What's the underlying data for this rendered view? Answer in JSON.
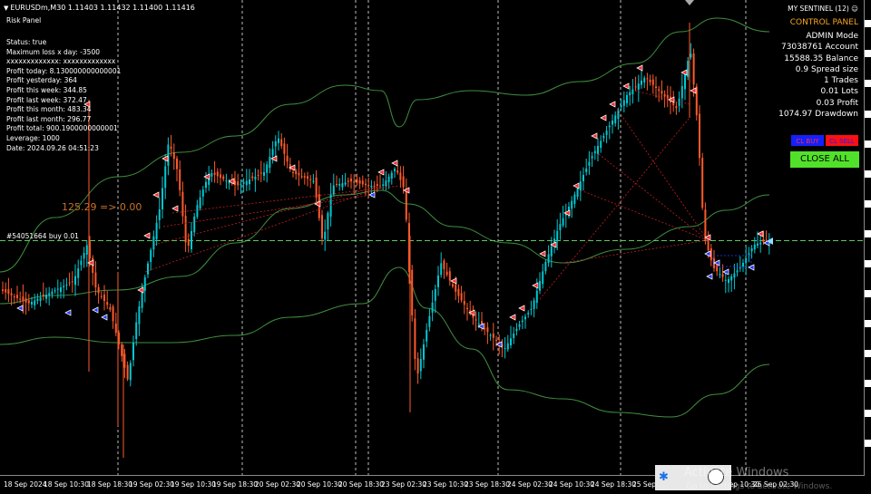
{
  "chart_header": {
    "symbol_line": "EURUSDm,M30  1.11403 1.11432 1.11400 1.11416",
    "risk_panel_title": "Risk Panel"
  },
  "risk_panel": {
    "lines": [
      "Status: true",
      "Maximum loss x day: -3500",
      "xxxxxxxxxxxxx: xxxxxxxxxxxxx",
      "Profit today: 8.130000000000001",
      "Profit yesterday: 364",
      "Profit this week: 344.85",
      "Profit last week: 372.47",
      "Profit this month: 483.34",
      "Profit last month: 296.77",
      "Profit total: 900.1900000000001",
      "Leverage: 1000",
      "Date: 2024.09.26 04:51:23"
    ]
  },
  "expert": {
    "name": "MY SENTINEL (12)",
    "icon": "smiley-icon"
  },
  "control_panel": {
    "title": "CONTROL PANEL",
    "rows": [
      {
        "value": "ADMIN",
        "label": "Mode"
      },
      {
        "value": "73038761",
        "label": "Account"
      },
      {
        "value": "15588.35",
        "label": "Balance"
      },
      {
        "value": "0.9",
        "label": "Spread size"
      },
      {
        "value": "1",
        "label": "Trades"
      },
      {
        "value": "0.01",
        "label": "Lots"
      },
      {
        "value": "0.03",
        "label": "Profit"
      },
      {
        "value": "1074.97",
        "label": "Drawdown"
      }
    ],
    "buy_label": "CL BUY",
    "sell_label": "CL SELL",
    "close_all_label": "CLOSE ALL"
  },
  "position_label": "#54051664 buy 0.01",
  "pl_label": "125.29 => 0.00",
  "x_axis_labels": [
    "18 Sep 2024",
    "18 Sep 10:30",
    "18 Sep 18:30",
    "19 Sep 02:30",
    "19 Sep 10:30",
    "19 Sep 18:30",
    "20 Sep 02:30",
    "20 Sep 10:30",
    "20 Sep 18:30",
    "23 Sep 02:30",
    "23 Sep 10:30",
    "23 Sep 18:30",
    "24 Sep 02:30",
    "24 Sep 10:30",
    "24 Sep 18:30",
    "25 Sep 02:30",
    "26 Sep 10:30",
    "26 Sep 02:30"
  ],
  "taskbar": {
    "bluetooth_icon": "bluetooth-icon",
    "watermark_title": "Activate Windows",
    "watermark_sub": "Go to Settings to activate Windows."
  },
  "colors": {
    "background": "#000000",
    "bull_candle": "#00c8d2",
    "bear_candle": "#ff5a2a",
    "bands": "#3f8f3f",
    "position_line": "#5fc85f",
    "control_title": "#f5a623",
    "close_all": "#52e12a",
    "buy_button": "#1520ff",
    "sell_button": "#ff1010"
  }
}
